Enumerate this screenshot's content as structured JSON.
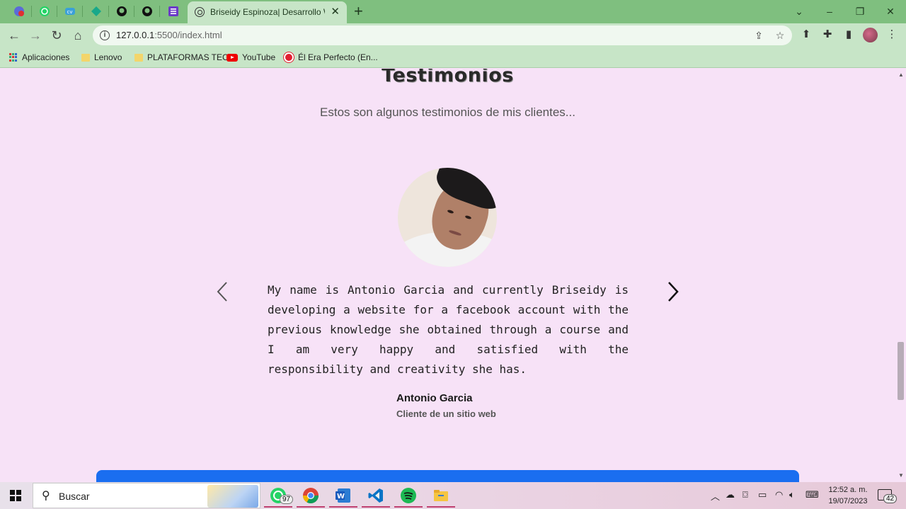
{
  "browser": {
    "tab_title": "Briseidy Espinoza| Desarrollo Web",
    "url_host": "127.0.0.1",
    "url_rest": ":5500/index.html",
    "bookmarks": [
      "Aplicaciones",
      "Lenovo",
      "PLATAFORMAS TEC",
      "YouTube",
      "Él Era Perfecto (En..."
    ]
  },
  "page": {
    "title": "Testimonios",
    "subtitle": "Estos son algunos testimonios de mis clientes...",
    "testimonial": {
      "quote": "My name is Antonio Garcia and currently Briseidy is developing a website for a facebook account with the previous knowledge she obtained through a course and I am very happy and satisfied with the responsibility and creativity she has.",
      "author": "Antonio Garcia",
      "role": "Cliente de un sitio web"
    }
  },
  "taskbar": {
    "search_placeholder": "Buscar",
    "whatsapp_badge": "97",
    "time": "12:52 a. m.",
    "date": "19/07/2023",
    "notifications": "42"
  },
  "colors": {
    "page_bg": "#f7e2f7",
    "tabstrip": "#7fbf7f",
    "toolbar": "#c7e5c7",
    "footer_bar": "#1a6ef0"
  }
}
